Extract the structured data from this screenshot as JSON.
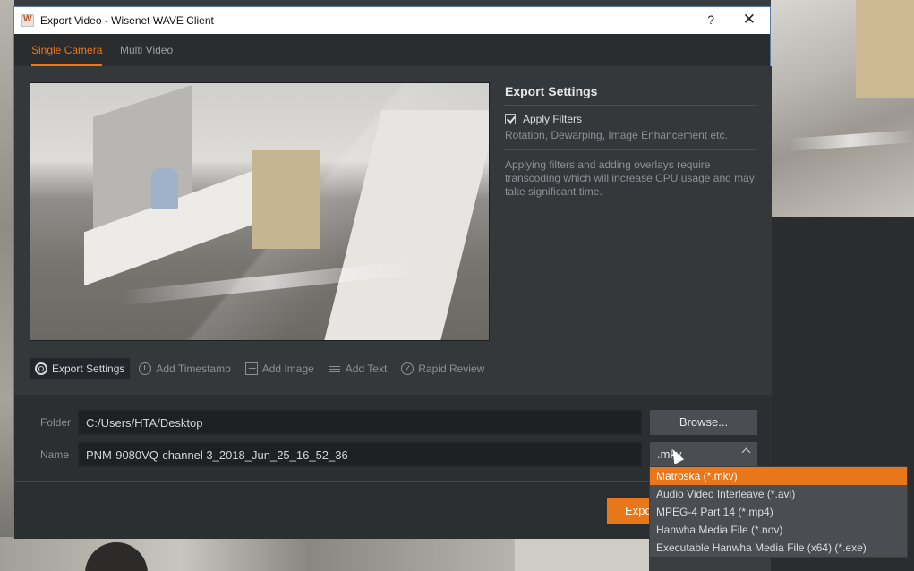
{
  "window": {
    "title": "Export Video - Wisenet WAVE Client",
    "help_label": "?",
    "close_label": "✕"
  },
  "tabs": [
    {
      "label": "Single Camera"
    },
    {
      "label": "Multi Video"
    }
  ],
  "settings": {
    "title": "Export Settings",
    "apply_filters_label": "Apply Filters",
    "apply_filters_checked": true,
    "apply_filters_sub": "Rotation, Dewarping, Image Enhancement etc.",
    "warning": "Applying filters and adding overlays require transcoding which will increase CPU usage and may take significant time."
  },
  "toolbar": [
    {
      "label": "Export Settings",
      "icon": "gear-icon"
    },
    {
      "label": "Add Timestamp",
      "icon": "clock-icon"
    },
    {
      "label": "Add Image",
      "icon": "image-icon"
    },
    {
      "label": "Add Text",
      "icon": "text-icon"
    },
    {
      "label": "Rapid Review",
      "icon": "rapid-review-icon"
    }
  ],
  "folder": {
    "label": "Folder",
    "value": "C:/Users/HTA/Desktop",
    "browse_label": "Browse..."
  },
  "name": {
    "label": "Name",
    "value": "PNM-9080VQ-channel 3_2018_Jun_25_16_52_36",
    "format_value": ".mkv"
  },
  "format_options": [
    "Matroska (*.mkv)",
    "Audio Video Interleave (*.avi)",
    "MPEG-4 Part 14 (*.mp4)",
    "Hanwha Media File (*.nov)",
    "Executable Hanwha Media File (x64) (*.exe)"
  ],
  "export_button": {
    "label": "Export"
  },
  "colors": {
    "accent": "#e8771c",
    "dialog_bg": "#2c2f31"
  }
}
